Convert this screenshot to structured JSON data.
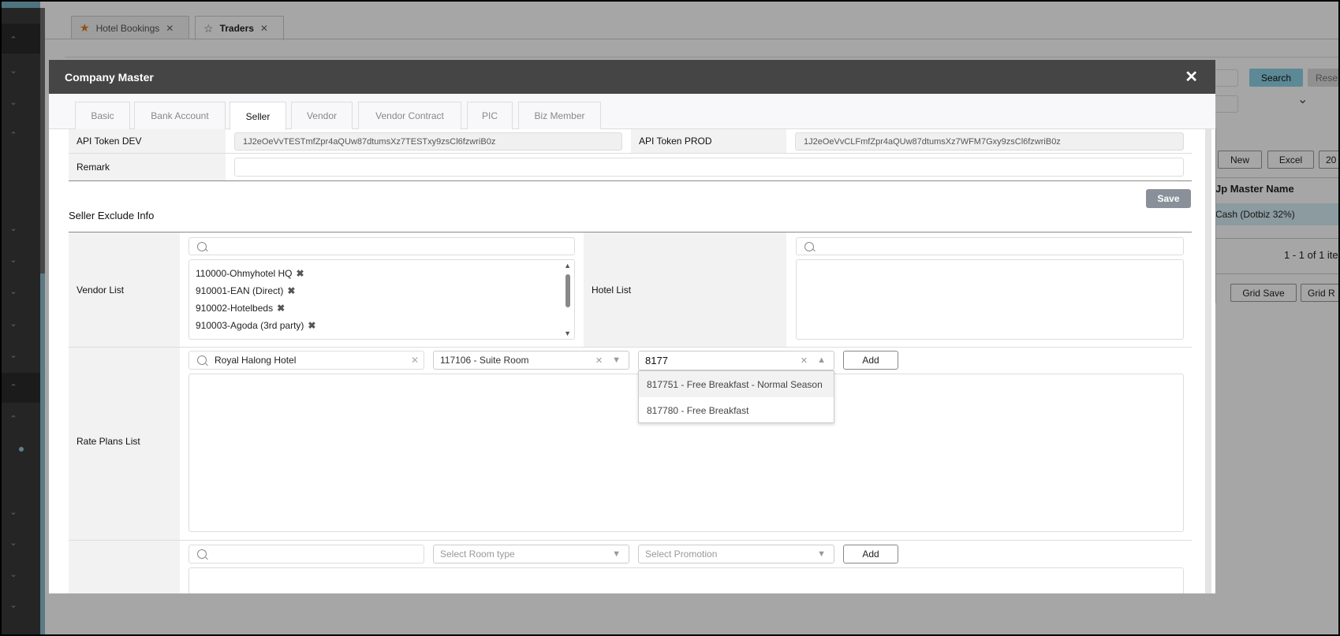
{
  "page_tabs": [
    {
      "label": "Hotel Bookings",
      "icon": "star-filled-icon"
    },
    {
      "label": "Traders",
      "icon": "star-outline-icon"
    }
  ],
  "background": {
    "search_label": "Search",
    "reset_label": "Rese",
    "new_label": "New",
    "excel_label": "Excel",
    "page_size": "20",
    "column_header": "Jp Master Name",
    "row_value": "Cash (Dotbiz 32%)",
    "pager": "1 - 1 of 1 ite",
    "grid_save_label": "Grid Save",
    "grid_reset_label": "Grid R"
  },
  "modal": {
    "title": "Company Master",
    "tabs": [
      "Basic",
      "Bank Account",
      "Seller",
      "Vendor",
      "Vendor Contract",
      "PIC",
      "Biz Member"
    ],
    "active_tab": "Seller",
    "api_token_dev_label": "API Token DEV",
    "api_token_dev": "1J2eOeVvTESTmfZpr4aQUw87dtumsXz7TESTxy9zsCl6fzwriB0z",
    "api_token_prod_label": "API Token PROD",
    "api_token_prod": "1J2eOeVvCLFmfZpr4aQUw87dtumsXz7WFM7Gxy9zsCl6fzwriB0z",
    "remark_label": "Remark",
    "remark_value": "",
    "save_label": "Save",
    "section_title": "Seller Exclude Info",
    "vendor_list_label": "Vendor List",
    "vendors": [
      "110000-Ohmyhotel HQ",
      "910001-EAN (Direct)",
      "910002-Hotelbeds",
      "910003-Agoda (3rd party)"
    ],
    "hotel_list_label": "Hotel List",
    "rate_plans_label": "Rate Plans List",
    "rate_hotel": "Royal Halong Hotel",
    "rate_room": "117106 - Suite Room",
    "rate_promo_input": "8177",
    "promo_options": [
      "817751 - Free Breakfast - Normal Season",
      "817780 - Free Breakfast"
    ],
    "add_label": "Add",
    "room_placeholder": "Select Room type",
    "promo_placeholder": "Select Promotion"
  }
}
